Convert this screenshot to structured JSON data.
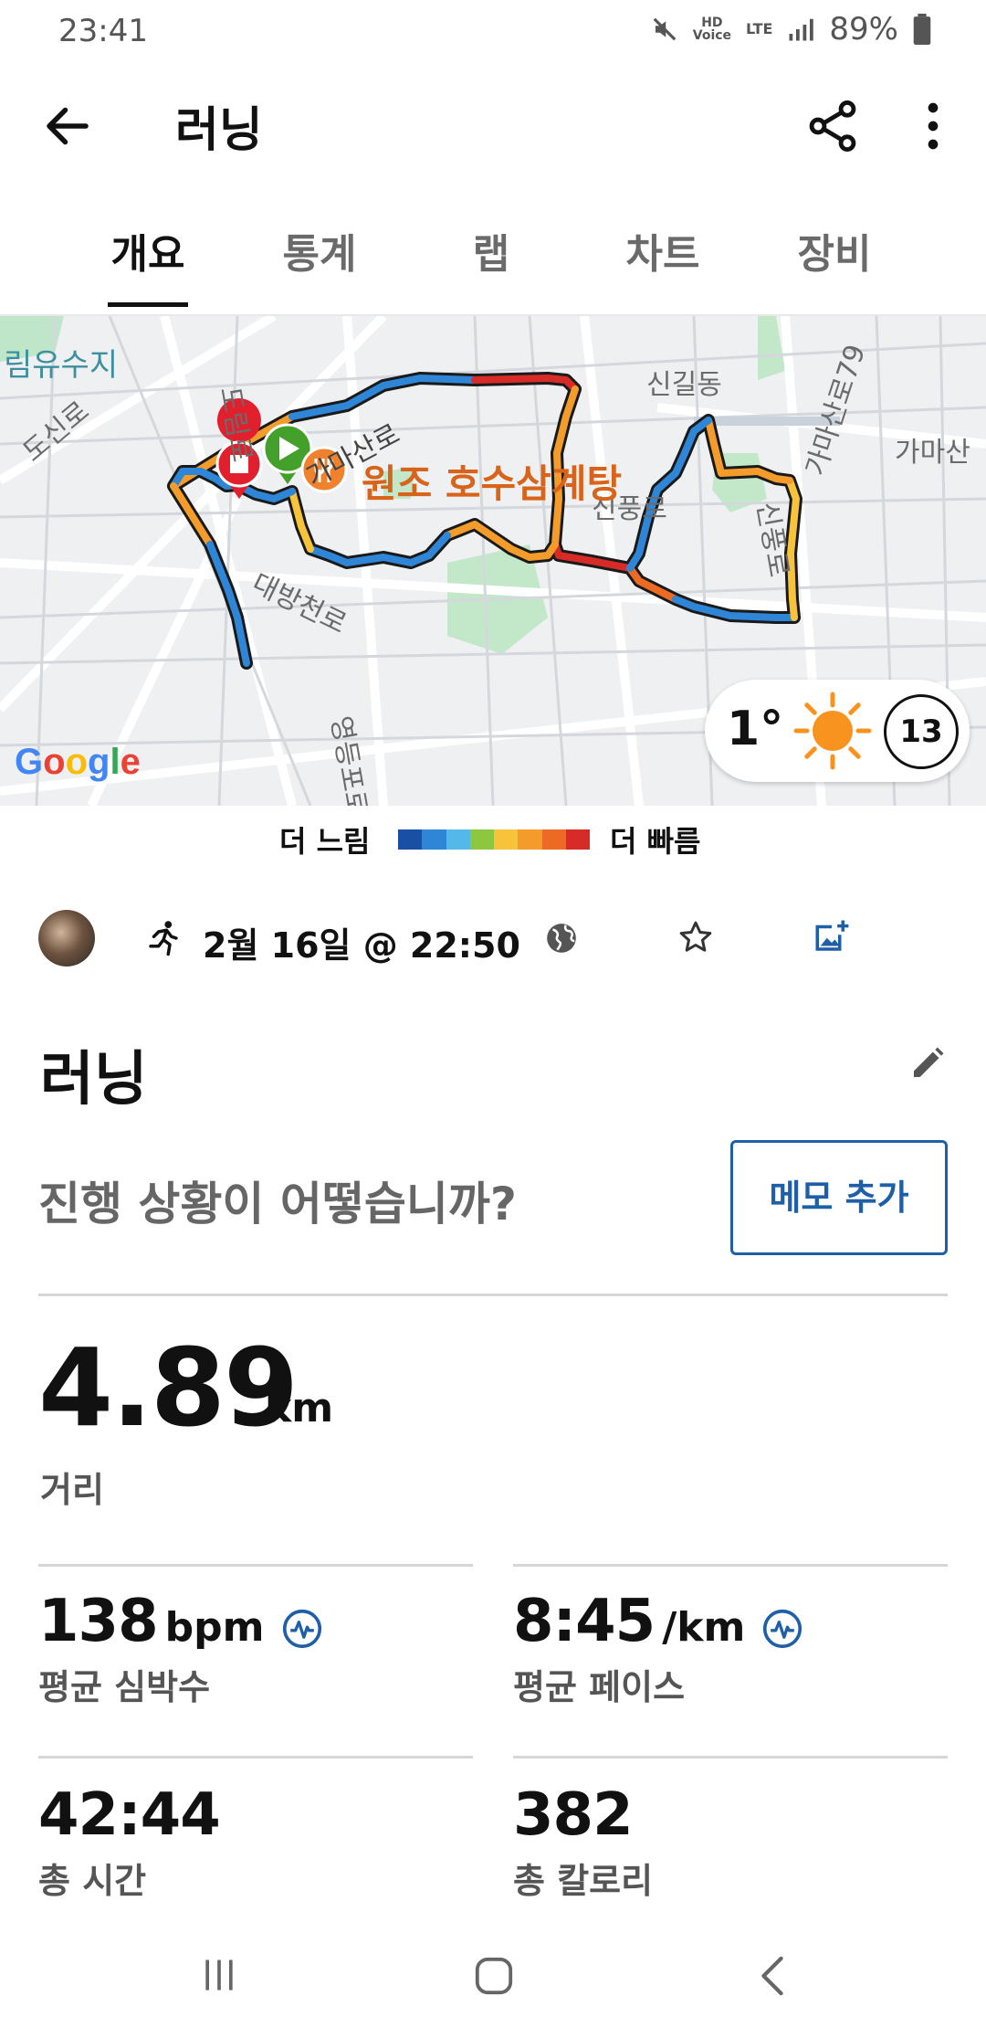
{
  "status_bar": {
    "time": "23:41",
    "hd_label": "HD",
    "voice_label": "Voice",
    "network_label": "LTE",
    "battery": "89%"
  },
  "app_bar": {
    "title": "러닝"
  },
  "tabs": [
    {
      "label": "개요",
      "active": true
    },
    {
      "label": "통계",
      "active": false
    },
    {
      "label": "랩",
      "active": false
    },
    {
      "label": "차트",
      "active": false
    },
    {
      "label": "장비",
      "active": false
    }
  ],
  "map": {
    "labels": {
      "reservoir": "림유수지",
      "doshin_ro": "도신로",
      "dorim_ro": "도림로",
      "gamasan_ro": "가마산로",
      "singil_dong": "신길동",
      "gamasan_ro_79": "가마산로79",
      "gamasan_right": "가마산",
      "singil_ro": "신풍로",
      "daebang_ro": "대방천로",
      "sinpung_ro": "신풍로",
      "yeongdeungpo_ro": "영등포로"
    },
    "poi": "원조 호수삼계탕",
    "attribution": "Google"
  },
  "weather": {
    "temperature": "1°",
    "wind": "13",
    "sun_color": "#f7931e"
  },
  "legend": {
    "slow_label": "더 느림",
    "fast_label": "더 빠름",
    "colors": [
      "#1b4fa5",
      "#2f86d6",
      "#54b8e8",
      "#8dc63f",
      "#f6c33a",
      "#f39c2b",
      "#ec6a23",
      "#d62b27"
    ]
  },
  "activity": {
    "date": "2월 16일 @ 22:50",
    "title": "러닝",
    "prompt": "진행 상황이 어떻습니까?",
    "memo_button": "메모 추가"
  },
  "distance": {
    "value": "4.89",
    "unit": "km",
    "label": "거리"
  },
  "stats": {
    "heart_rate": {
      "value": "138",
      "unit": "bpm",
      "label": "평균 심박수"
    },
    "pace": {
      "value": "8:45",
      "unit": "/km",
      "label": "평균 페이스"
    },
    "time": {
      "value": "42:44",
      "label": "총 시간"
    },
    "calories": {
      "value": "382",
      "label": "총 칼로리"
    }
  },
  "colors": {
    "accent_blue": "#1f5fa8",
    "start_marker": "#43a02a",
    "stop_marker": "#e21f2d"
  }
}
